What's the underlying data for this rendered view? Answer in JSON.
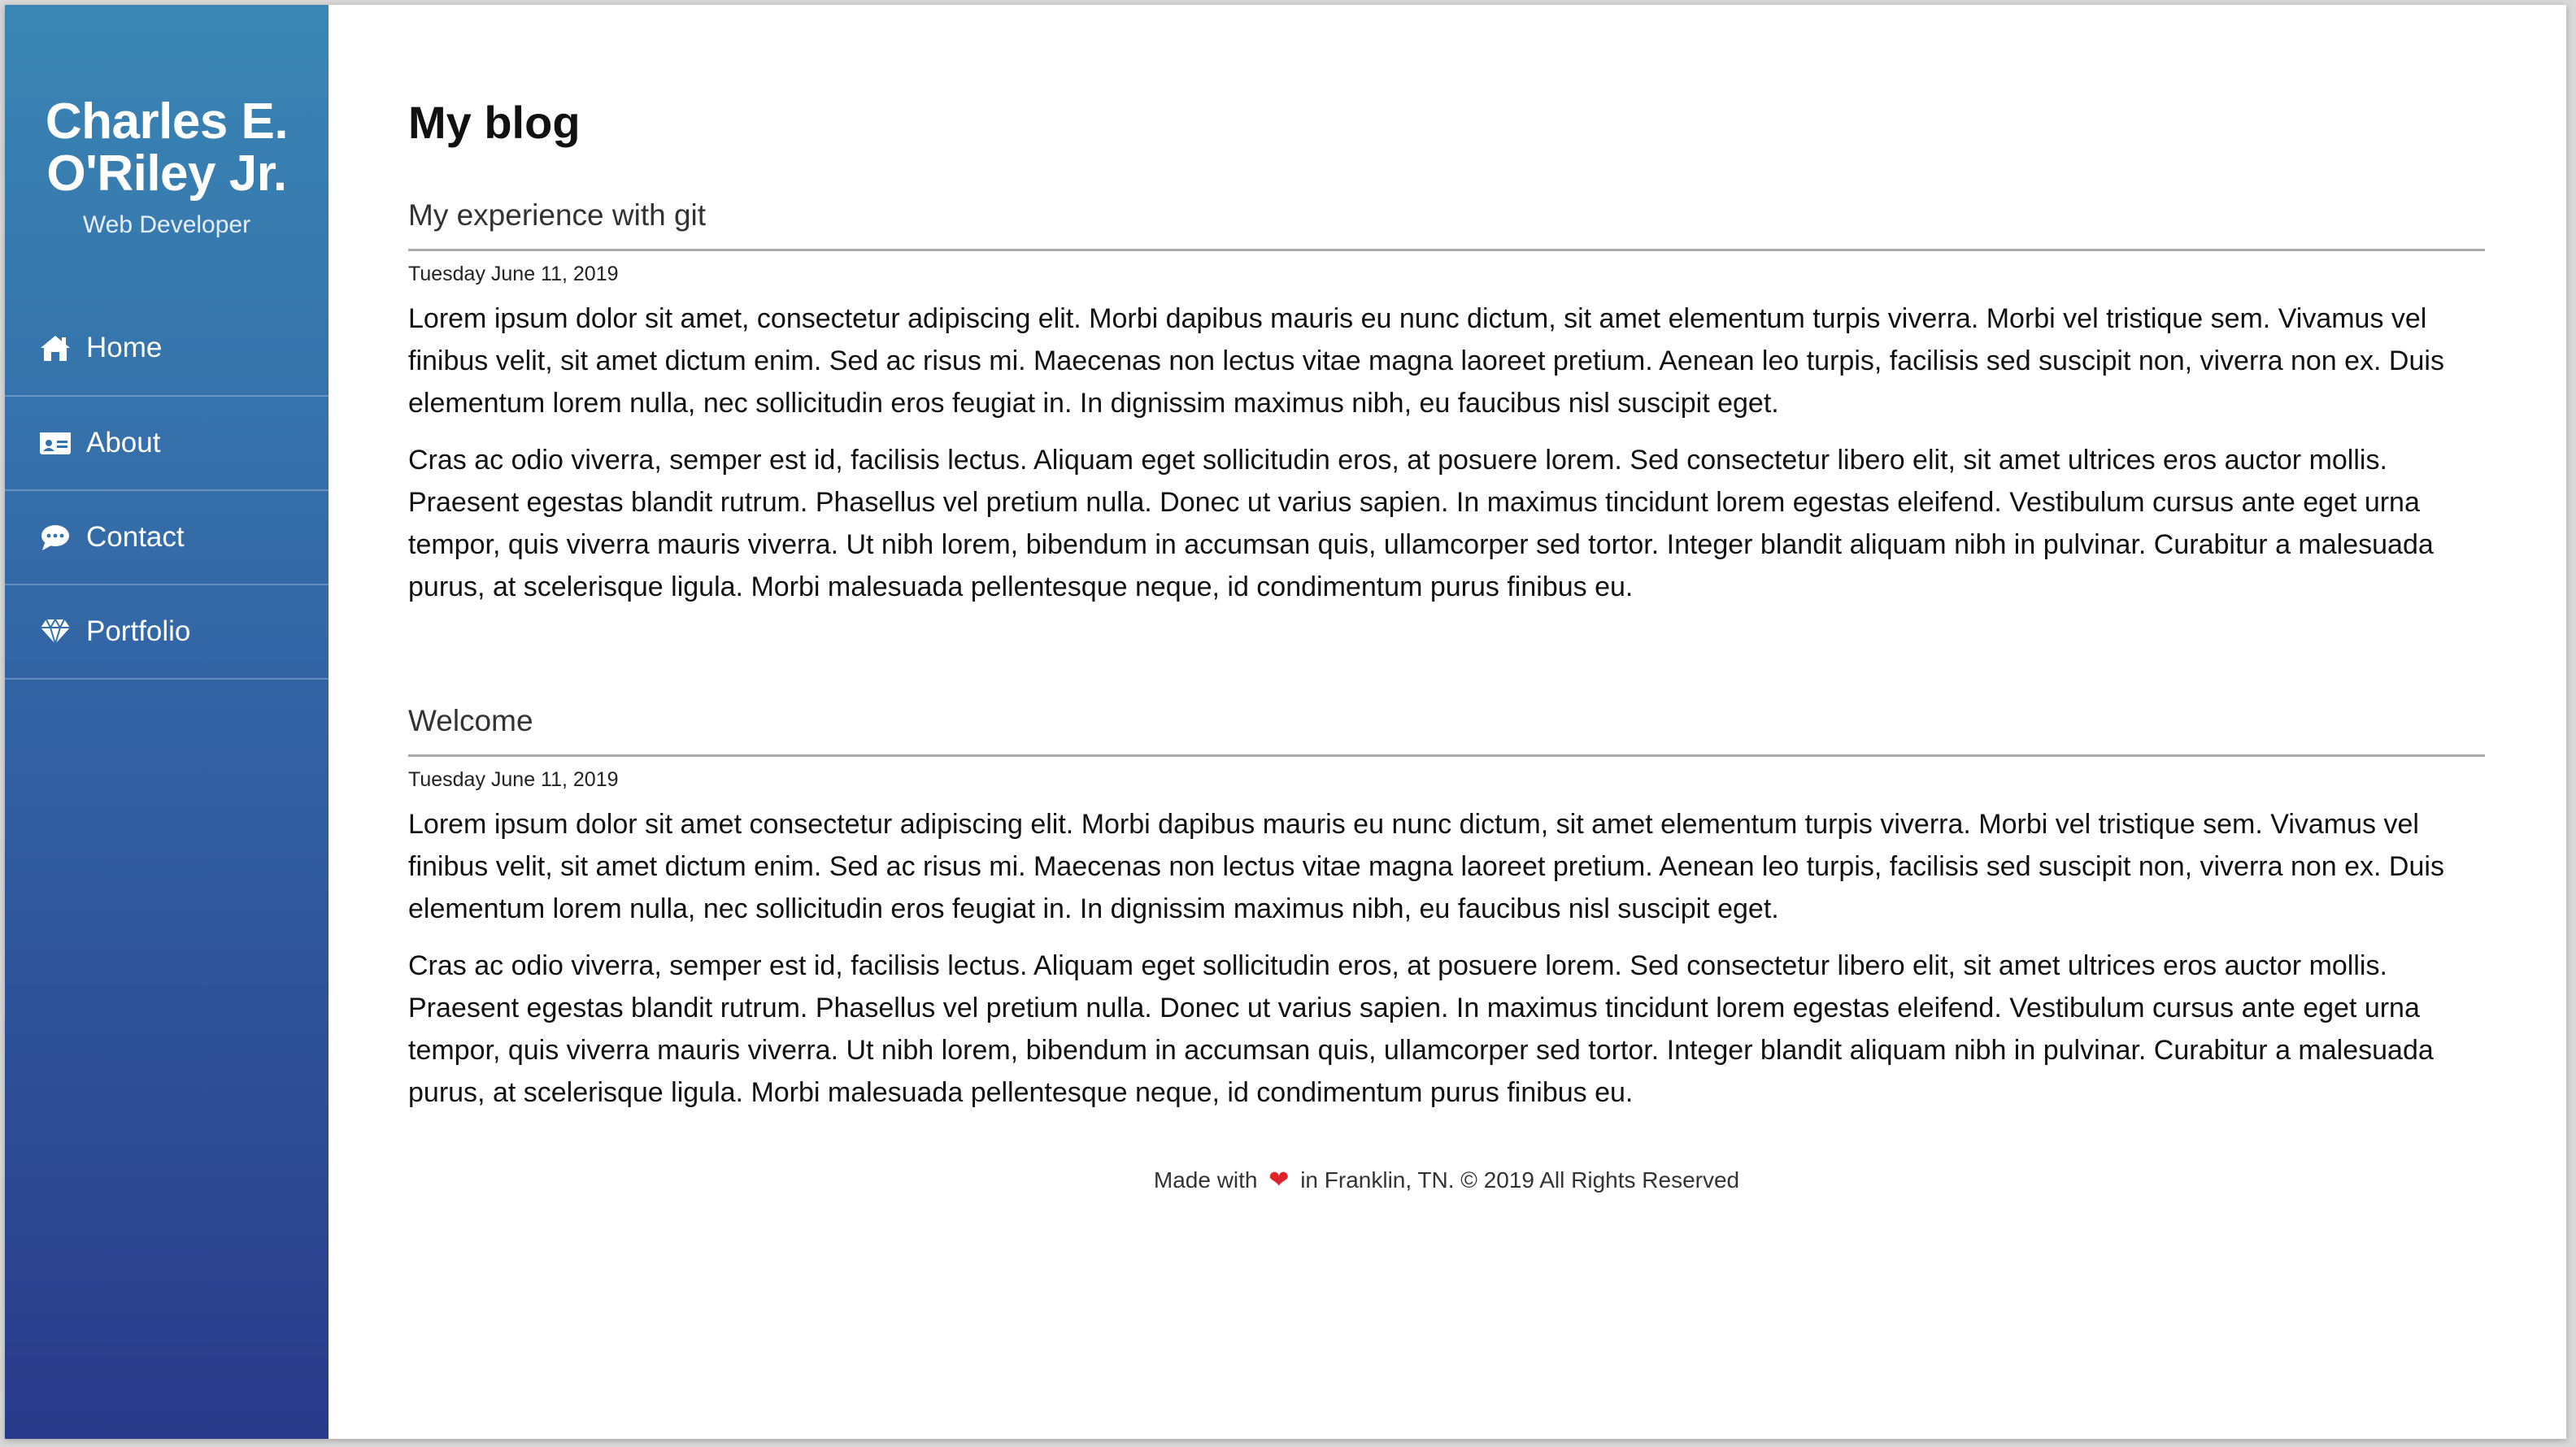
{
  "sidebar": {
    "name_line1": "Charles E.",
    "name_line2": "O'Riley Jr.",
    "role": "Web Developer",
    "items": [
      {
        "label": "Home",
        "icon": "home-icon"
      },
      {
        "label": "About",
        "icon": "id-card-icon"
      },
      {
        "label": "Contact",
        "icon": "chat-icon"
      },
      {
        "label": "Portfolio",
        "icon": "gem-icon"
      }
    ]
  },
  "main": {
    "title": "My blog",
    "posts": [
      {
        "title": "My experience with git",
        "date": "Tuesday June 11, 2019",
        "paragraphs": [
          "Lorem ipsum dolor sit amet, consectetur adipiscing elit. Morbi dapibus mauris eu nunc dictum, sit amet elementum turpis viverra. Morbi vel tristique sem. Vivamus vel finibus velit, sit amet dictum enim. Sed ac risus mi. Maecenas non lectus vitae magna laoreet pretium. Aenean leo turpis, facilisis sed suscipit non, viverra non ex. Duis elementum lorem nulla, nec sollicitudin eros feugiat in. In dignissim maximus nibh, eu faucibus nisl suscipit eget.",
          "Cras ac odio viverra, semper est id, facilisis lectus. Aliquam eget sollicitudin eros, at posuere lorem. Sed consectetur libero elit, sit amet ultrices eros auctor mollis. Praesent egestas blandit rutrum. Phasellus vel pretium nulla. Donec ut varius sapien. In maximus tincidunt lorem egestas eleifend. Vestibulum cursus ante eget urna tempor, quis viverra mauris viverra. Ut nibh lorem, bibendum in accumsan quis, ullamcorper sed tortor. Integer blandit aliquam nibh in pulvinar. Curabitur a malesuada purus, at scelerisque ligula. Morbi malesuada pellentesque neque, id condimentum purus finibus eu."
        ]
      },
      {
        "title": "Welcome",
        "date": "Tuesday June 11, 2019",
        "paragraphs": [
          "Lorem ipsum dolor sit amet consectetur adipiscing elit. Morbi dapibus mauris eu nunc dictum, sit amet elementum turpis viverra. Morbi vel tristique sem. Vivamus vel finibus velit, sit amet dictum enim. Sed ac risus mi. Maecenas non lectus vitae magna laoreet pretium. Aenean leo turpis, facilisis sed suscipit non, viverra non ex. Duis elementum lorem nulla, nec sollicitudin eros feugiat in. In dignissim maximus nibh, eu faucibus nisl suscipit eget.",
          "Cras ac odio viverra, semper est id, facilisis lectus. Aliquam eget sollicitudin eros, at posuere lorem. Sed consectetur libero elit, sit amet ultrices eros auctor mollis. Praesent egestas blandit rutrum. Phasellus vel pretium nulla. Donec ut varius sapien. In maximus tincidunt lorem egestas eleifend. Vestibulum cursus ante eget urna tempor, quis viverra mauris viverra. Ut nibh lorem, bibendum in accumsan quis, ullamcorper sed tortor. Integer blandit aliquam nibh in pulvinar. Curabitur a malesuada purus, at scelerisque ligula. Morbi malesuada pellentesque neque, id condimentum purus finibus eu."
        ]
      }
    ]
  },
  "footer": {
    "prefix": "Made with",
    "heart_icon": "heart-icon",
    "suffix": "in Franklin, TN. © 2019 All Rights Reserved"
  },
  "colors": {
    "sidebar_top": "#3a86b4",
    "sidebar_bottom": "#2a3a8a",
    "heart": "#e0232b"
  }
}
